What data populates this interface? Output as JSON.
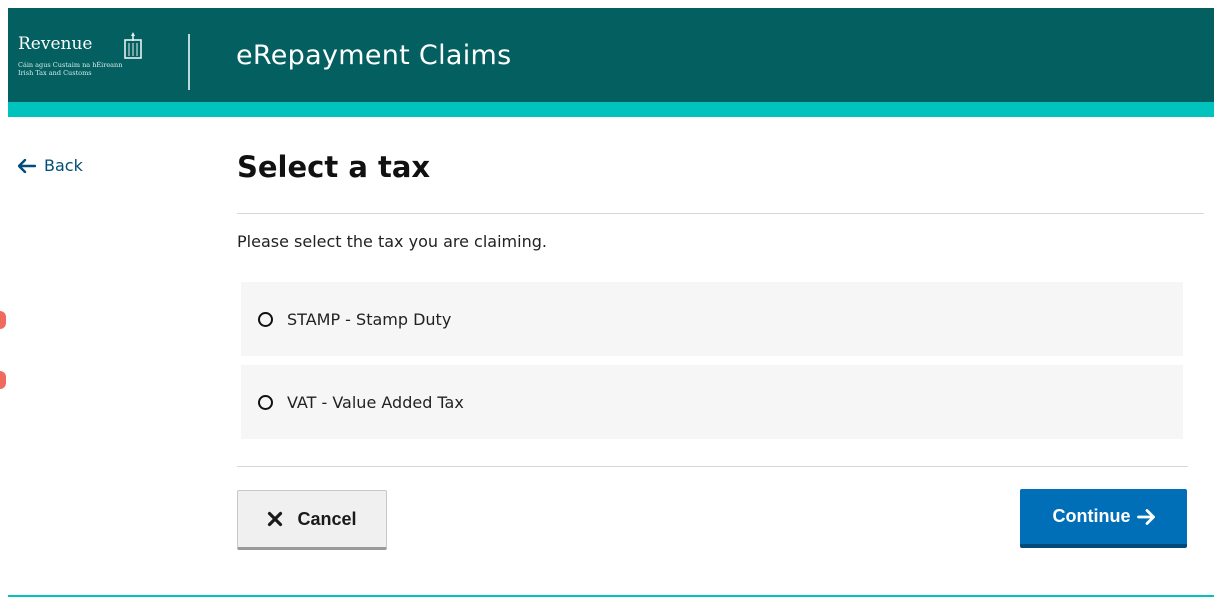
{
  "header": {
    "logo_word": "Revenue",
    "logo_sub_line1": "Cáin agus Custaim na hÉireann",
    "logo_sub_line2": "Irish Tax and Customs",
    "app_title": "eRepayment Claims"
  },
  "nav": {
    "back_label": "Back"
  },
  "page": {
    "title": "Select a tax",
    "instruction": "Please select the tax you are claiming."
  },
  "options": [
    {
      "label": "STAMP - Stamp Duty",
      "selected": false
    },
    {
      "label": "VAT - Value Added Tax",
      "selected": false
    }
  ],
  "actions": {
    "cancel_label": "Cancel",
    "continue_label": "Continue"
  },
  "colors": {
    "header_bg": "#035f60",
    "header_accent": "#00c3be",
    "primary_button": "#006fb7",
    "link": "#004d7a"
  }
}
